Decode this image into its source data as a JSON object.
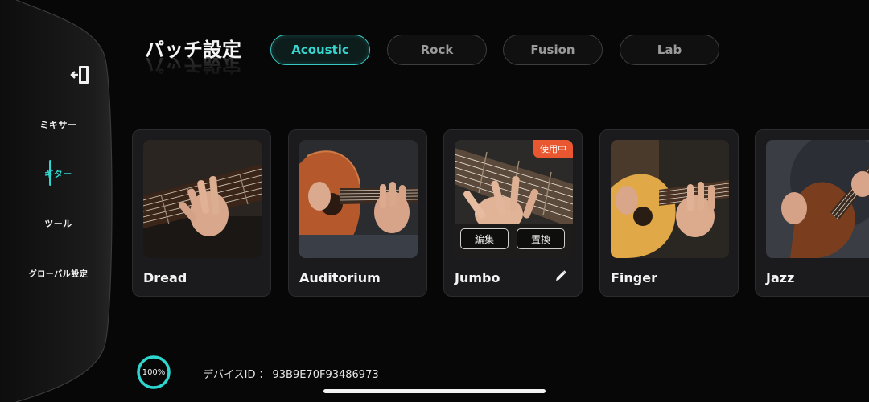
{
  "header": {
    "title": "パッチ設定",
    "tabs": [
      {
        "label": "Acoustic",
        "active": true
      },
      {
        "label": "Rock",
        "active": false
      },
      {
        "label": "Fusion",
        "active": false
      },
      {
        "label": "Lab",
        "active": false
      }
    ]
  },
  "sidebar": {
    "exit_icon": "exit-door-icon",
    "items": [
      {
        "label": "ミキサー",
        "active": false
      },
      {
        "label": "ギター",
        "active": true
      },
      {
        "label": "ツール",
        "active": false
      },
      {
        "label": "グローバル設定",
        "active": false
      }
    ]
  },
  "patches": [
    {
      "name": "Dread"
    },
    {
      "name": "Auditorium"
    },
    {
      "name": "Jumbo",
      "badge": "使用中",
      "actions": [
        "編集",
        "置換"
      ],
      "edit_icon": "pencil-icon"
    },
    {
      "name": "Finger"
    },
    {
      "name": "Jazz"
    }
  ],
  "footer": {
    "progress_label": "100%",
    "progress_value": 1.0,
    "device_id_label": "デバイスID",
    "device_id_separator": "：",
    "device_id_value": "93B9E70F93486973"
  },
  "colors": {
    "accent": "#2fd6d0",
    "badge": "#e8572f",
    "background": "#070707",
    "card": "#1b1b1d"
  }
}
